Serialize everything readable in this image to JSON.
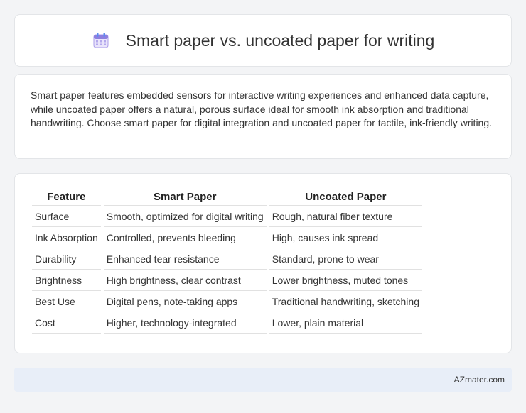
{
  "header": {
    "title": "Smart paper vs. uncoated paper for writing",
    "icon": "calendar-icon"
  },
  "intro": {
    "text": "Smart paper features embedded sensors for interactive writing experiences and enhanced data capture, while uncoated paper offers a natural, porous surface ideal for smooth ink absorption and traditional handwriting. Choose smart paper for digital integration and uncoated paper for tactile, ink-friendly writing."
  },
  "table": {
    "headers": [
      "Feature",
      "Smart Paper",
      "Uncoated Paper"
    ],
    "rows": [
      [
        "Surface",
        "Smooth, optimized for digital writing",
        "Rough, natural fiber texture"
      ],
      [
        "Ink Absorption",
        "Controlled, prevents bleeding",
        "High, causes ink spread"
      ],
      [
        "Durability",
        "Enhanced tear resistance",
        "Standard, prone to wear"
      ],
      [
        "Brightness",
        "High brightness, clear contrast",
        "Lower brightness, muted tones"
      ],
      [
        "Best Use",
        "Digital pens, note-taking apps",
        "Traditional handwriting, sketching"
      ],
      [
        "Cost",
        "Higher, technology-integrated",
        "Lower, plain material"
      ]
    ]
  },
  "footer": {
    "brand": "AZmater.com"
  }
}
